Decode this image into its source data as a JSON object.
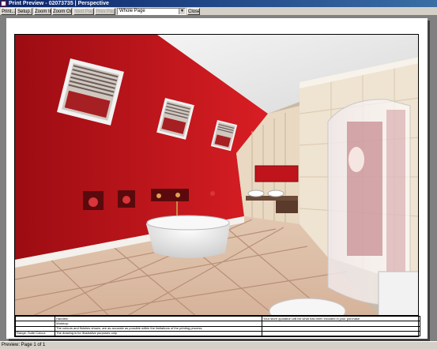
{
  "window": {
    "title": "Print Preview - 02073735 | Perspective"
  },
  "toolbar": {
    "print": "Print...",
    "setup": "Setup...",
    "zoom_in": "Zoom In",
    "zoom_out": "Zoom Out",
    "next_page": "Next Page",
    "prev_page": "Prev Page",
    "zoom_value": "Whole Page",
    "close": "Close"
  },
  "info_block": {
    "rows": [
      {
        "left": "",
        "label": "Handles:",
        "note": "Your store quotation will list what has been included in your purchase."
      },
      {
        "left": "",
        "label": "Worktop:",
        "note": ""
      },
      {
        "left": "",
        "label": "The colours and finishes shown, are as accurate as possible within the limitations of the printing process.",
        "note": ""
      },
      {
        "left": "Range: Suite Colour:",
        "label": "The drawing is for illustrative purposes only.",
        "note": ""
      }
    ]
  },
  "status": {
    "text": "Preview: Page 1 of 1"
  },
  "colors": {
    "wall_red": "#c0141c",
    "title_blue": "#0a246a",
    "toolbar_grey": "#d4d0c8"
  }
}
